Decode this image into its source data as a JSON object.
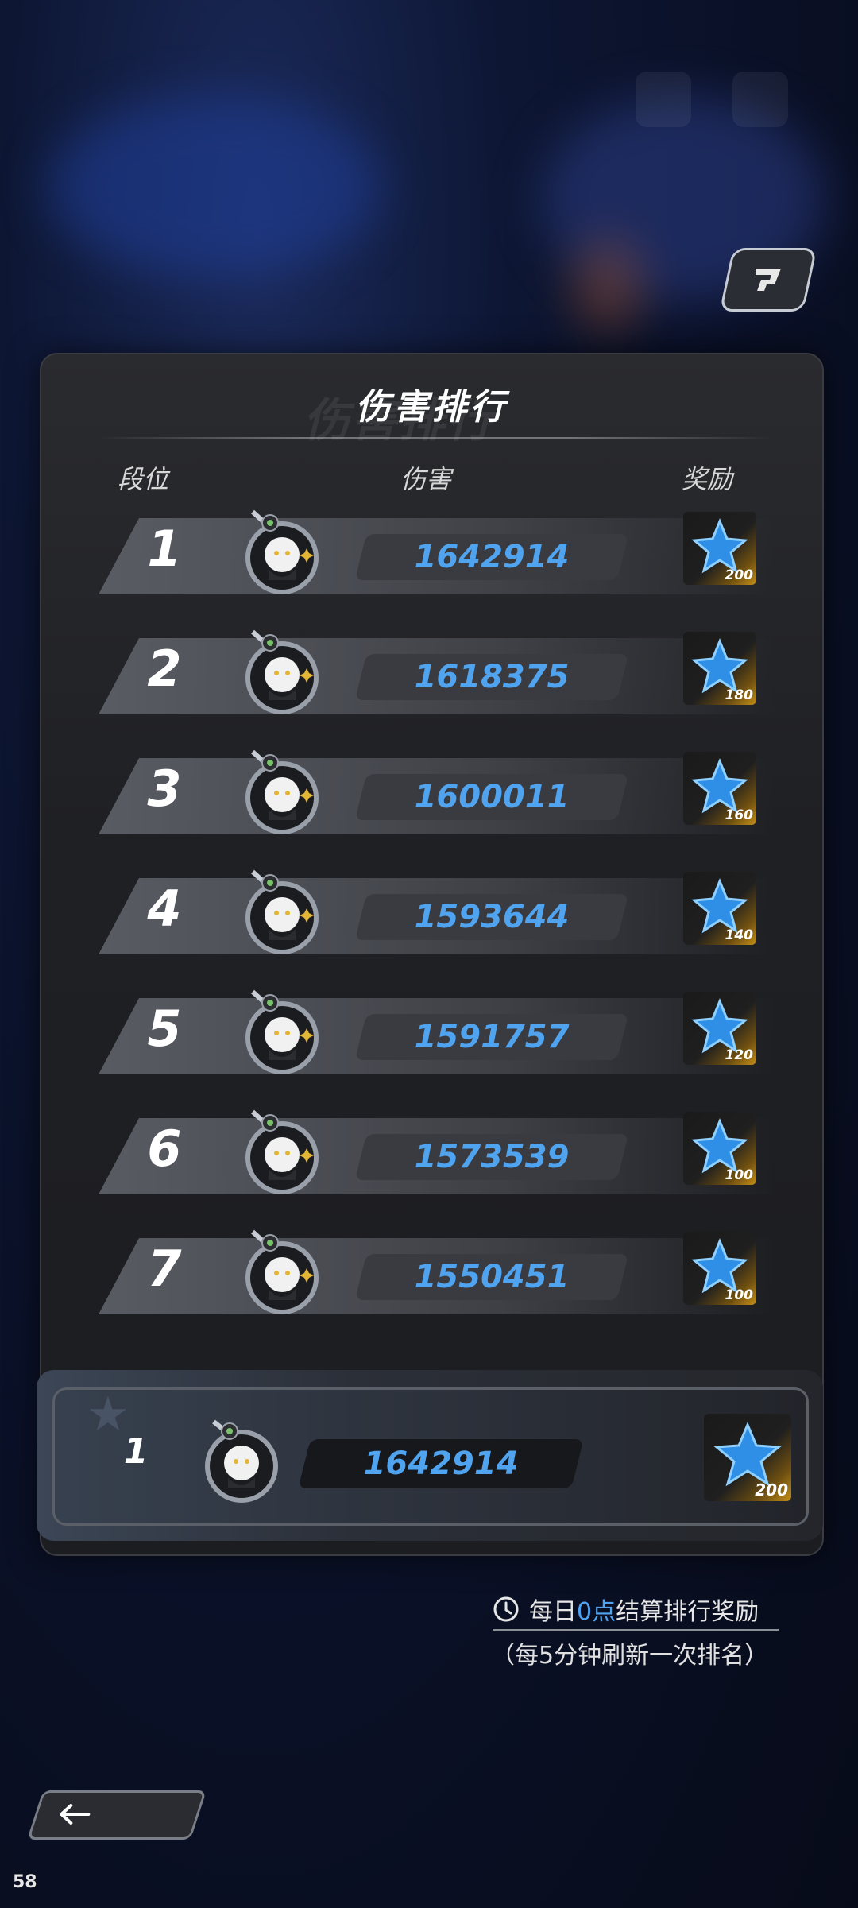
{
  "title": "伤害排行",
  "title_ghost": "伤害排行",
  "headers": {
    "rank": "段位",
    "damage": "伤害",
    "reward": "奖励"
  },
  "rows": [
    {
      "rank": "1",
      "damage": "1642914",
      "reward": "200"
    },
    {
      "rank": "2",
      "damage": "1618375",
      "reward": "180"
    },
    {
      "rank": "3",
      "damage": "1600011",
      "reward": "160"
    },
    {
      "rank": "4",
      "damage": "1593644",
      "reward": "140"
    },
    {
      "rank": "5",
      "damage": "1591757",
      "reward": "120"
    },
    {
      "rank": "6",
      "damage": "1573539",
      "reward": "100"
    },
    {
      "rank": "7",
      "damage": "1550451",
      "reward": "100"
    }
  ],
  "self": {
    "rank": "1",
    "damage": "1642914",
    "reward": "200"
  },
  "notice": {
    "prefix": "每日",
    "highlight": "0点",
    "suffix": "结算排行奖励",
    "sub": "（每5分钟刷新一次排名）"
  },
  "fps": "58",
  "colors": {
    "accent": "#4fa3ef",
    "reward_gold": "#c48f18",
    "panel": "#1f2024"
  },
  "icons": {
    "clock": "clock-icon",
    "back": "back-arrow-icon",
    "reward": "blue-star-icon",
    "top_right": "share-icon"
  }
}
